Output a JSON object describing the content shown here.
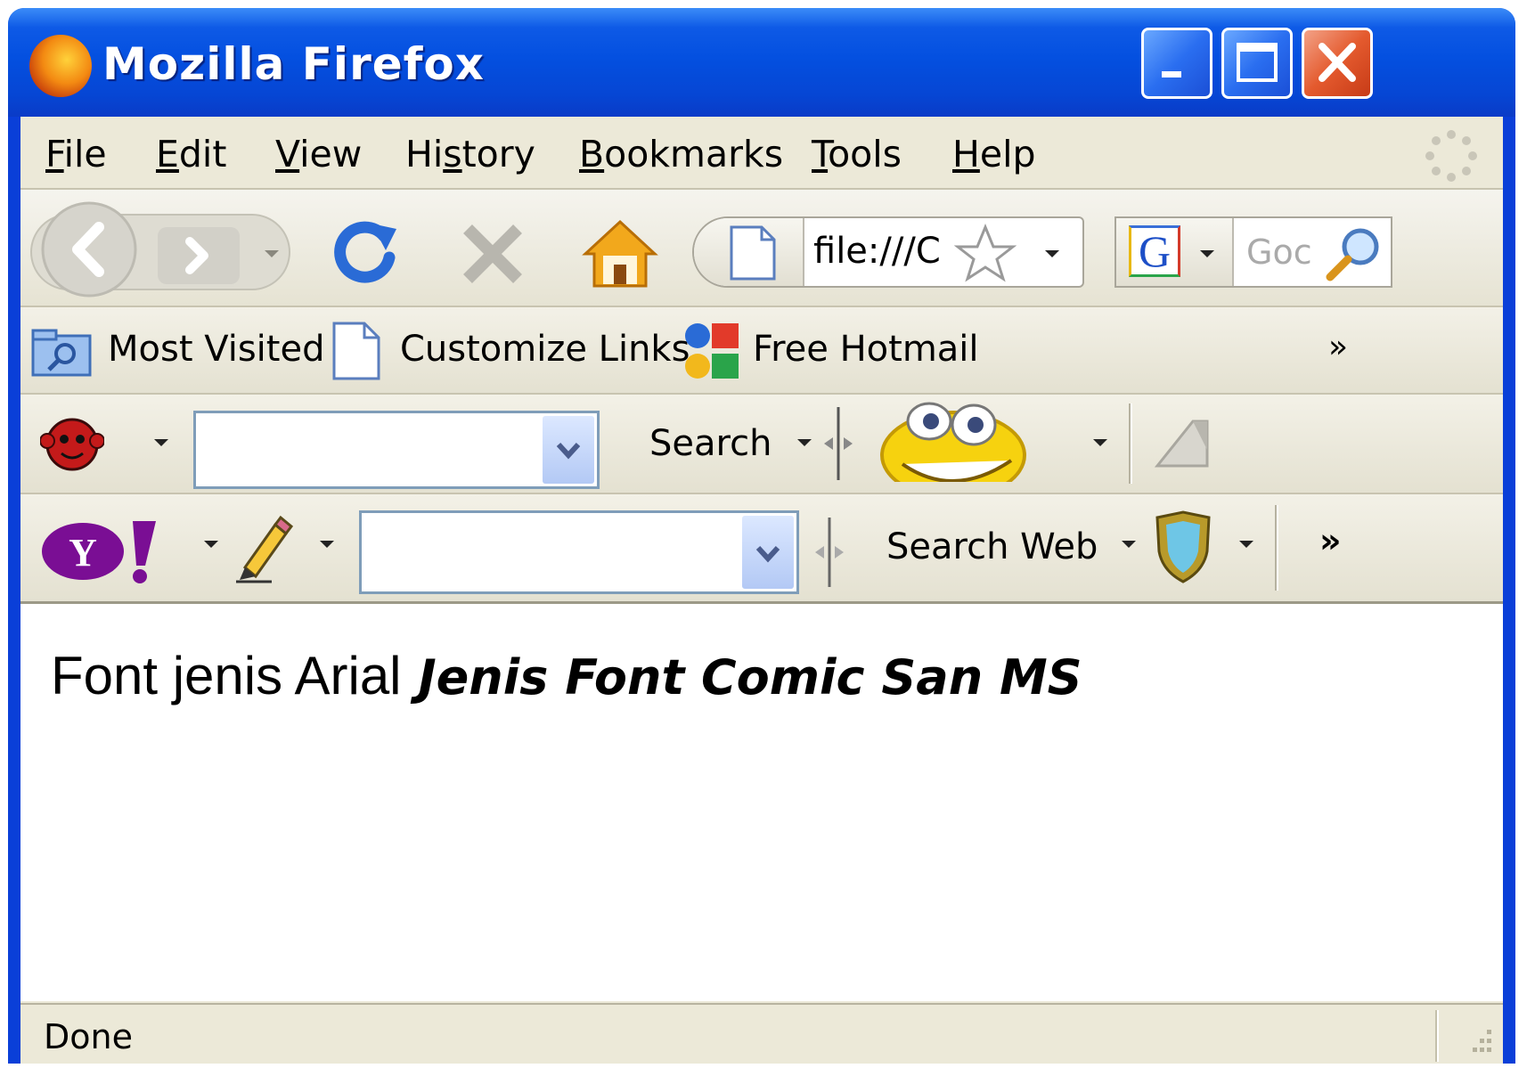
{
  "window": {
    "title": "Mozilla Firefox"
  },
  "menubar": {
    "items": [
      {
        "label": "File",
        "accel": "F",
        "rest": "ile"
      },
      {
        "label": "Edit",
        "accel": "E",
        "rest": "dit"
      },
      {
        "label": "View",
        "accel": "V",
        "rest": "iew"
      },
      {
        "label": "History",
        "pre": "Hi",
        "accel": "s",
        "rest": "tory"
      },
      {
        "label": "Bookmarks",
        "accel": "B",
        "rest": "ookmarks"
      },
      {
        "label": "Tools",
        "accel": "T",
        "rest": "ools"
      },
      {
        "label": "Help",
        "accel": "H",
        "rest": "elp"
      }
    ]
  },
  "navbar": {
    "url": "file:///C",
    "search_placeholder": "Goc"
  },
  "bookmarks": {
    "items": [
      "Most Visited",
      "Customize Links",
      "Free Hotmail"
    ],
    "overflow": "»"
  },
  "toolbar3": {
    "search_label": "Search"
  },
  "toolbar4": {
    "search_web_label": "Search Web",
    "overflow": "»"
  },
  "content": {
    "arial_text": "Font jenis Arial",
    "comic_text": "Jenis Font Comic San MS"
  },
  "statusbar": {
    "text": "Done"
  },
  "colors": {
    "titlebar": "#0450e0",
    "chrome": "#ece9d8",
    "close_button": "#e45a2e"
  }
}
